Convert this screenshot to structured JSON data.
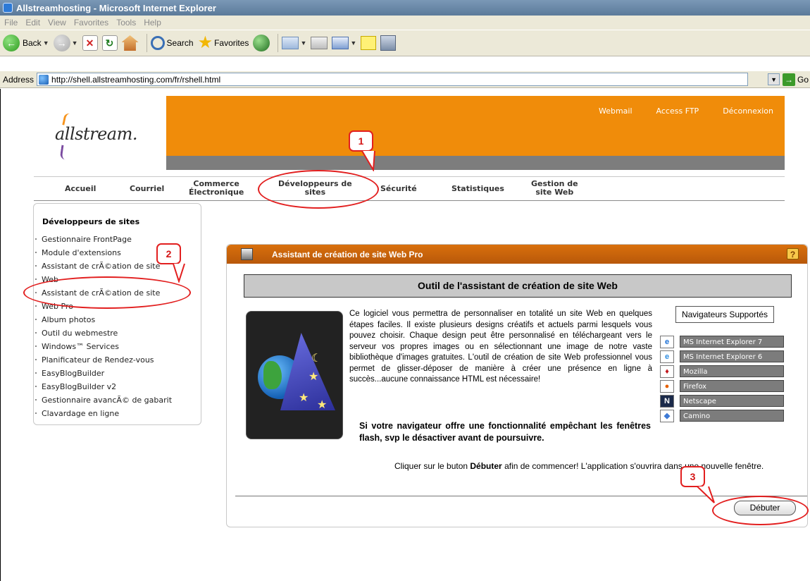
{
  "window": {
    "title": "Allstreamhosting - Microsoft Internet Explorer"
  },
  "menubar": [
    "File",
    "Edit",
    "View",
    "Favorites",
    "Tools",
    "Help"
  ],
  "toolbar": {
    "back_label": "Back",
    "search_label": "Search",
    "favorites_label": "Favorites"
  },
  "address": {
    "label": "Address",
    "url": "http://shell.allstreamhosting.com/fr/rshell.html",
    "go_label": "Go"
  },
  "site": {
    "logo_text": "allstream.",
    "toplinks": [
      "Webmail",
      "Access FTP",
      "Déconnexion"
    ],
    "nav": {
      "accueil": "Accueil",
      "courriel": "Courriel",
      "commerce": [
        "Commerce",
        "Électronique"
      ],
      "developpeurs": [
        "Développeurs de",
        "sites"
      ],
      "securite": "Sécurité",
      "statistiques": "Statistiques",
      "gestion": [
        "Gestion de",
        "site Web"
      ]
    }
  },
  "sidebar": {
    "title": "Développeurs de sites",
    "items": [
      "Gestionnaire FrontPage",
      "Module d'extensions",
      "Assistant de crÃ©ation de site",
      "Web",
      "Assistant de crÃ©ation de site",
      "Web Pro",
      "Album photos",
      "Outil du webmestre",
      "Windows™ Services",
      "Planificateur de Rendez-vous",
      "EasyBlogBuilder",
      "EasyBlogBuilder v2",
      "Gestionnaire avancÃ© de gabarit",
      "Clavardage en ligne"
    ]
  },
  "panel": {
    "title": "Assistant de création de site Web Pro",
    "help": "?",
    "tool_header": "Outil de l'assistant de création de site Web",
    "description": "Ce logiciel vous permettra de personnaliser en totalité un site Web en quelques étapes faciles. Il existe plusieurs designs créatifs et actuels parmi lesquels vous pouvez choisir. Chaque design peut être personnalisé en téléchargeant vers le serveur vos propres images ou en sélectionnant une image de notre vaste bibliothèque d'images gratuites. L'outil de création de site Web professionnel vous permet de glisser-déposer de manière à créer une présence en ligne à succès...aucune connaissance HTML est nécessaire!",
    "warning": "Si votre navigateur offre une fonctionnalité empêchant les fenêtres flash, svp le désactiver avant de poursuivre.",
    "browsers_title": "Navigateurs Supportés",
    "browsers": [
      {
        "name": "MS Internet Explorer 7",
        "icon": "ie7-icon"
      },
      {
        "name": "MS Internet Explorer 6",
        "icon": "ie6-icon"
      },
      {
        "name": "Mozilla",
        "icon": "mozilla-icon"
      },
      {
        "name": "Firefox",
        "icon": "firefox-icon"
      },
      {
        "name": "Netscape",
        "icon": "netscape-icon"
      },
      {
        "name": "Camino",
        "icon": "camino-icon"
      }
    ],
    "start_text_pre": "Cliquer sur le buton ",
    "start_text_bold": "Débuter",
    "start_text_post": " afin de commencer! L'application s'ouvrira dans une nouvelle fenêtre.",
    "start_button": "Débuter"
  },
  "annotations": {
    "one": "1",
    "two": "2",
    "three": "3"
  },
  "colors": {
    "accent_orange": "#f08c0a",
    "header_grey": "#7d7d7d",
    "annotation_red": "#e21f1f"
  }
}
